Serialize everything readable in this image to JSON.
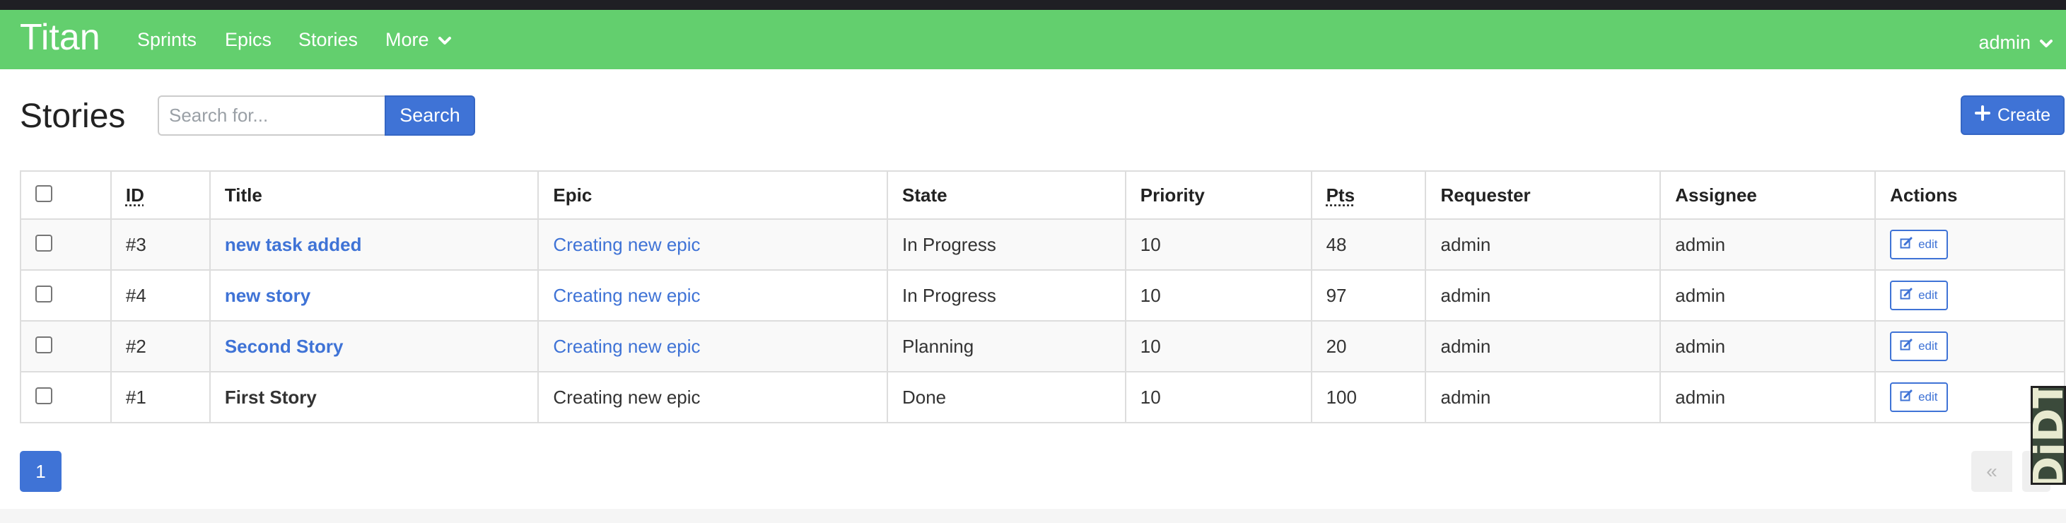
{
  "navbar": {
    "brand": "Titan",
    "items": [
      {
        "label": "Sprints"
      },
      {
        "label": "Epics"
      },
      {
        "label": "Stories"
      },
      {
        "label": "More"
      }
    ],
    "user": "admin"
  },
  "page": {
    "title": "Stories"
  },
  "search": {
    "placeholder": "Search for...",
    "button_label": "Search"
  },
  "create_button": {
    "label": "Create",
    "icon": "plus-icon"
  },
  "table": {
    "columns": [
      "ID",
      "Title",
      "Epic",
      "State",
      "Priority",
      "Pts",
      "Requester",
      "Assignee",
      "Actions"
    ],
    "rows": [
      {
        "id": "#3",
        "title": "new task added",
        "title_linked": true,
        "epic": "Creating new epic",
        "epic_linked": true,
        "state": "In Progress",
        "priority": "10",
        "pts": "48",
        "requester": "admin",
        "assignee": "admin",
        "action": "edit"
      },
      {
        "id": "#4",
        "title": "new story",
        "title_linked": true,
        "epic": "Creating new epic",
        "epic_linked": true,
        "state": "In Progress",
        "priority": "10",
        "pts": "97",
        "requester": "admin",
        "assignee": "admin",
        "action": "edit"
      },
      {
        "id": "#2",
        "title": "Second Story",
        "title_linked": true,
        "epic": "Creating new epic",
        "epic_linked": true,
        "state": "Planning",
        "priority": "10",
        "pts": "20",
        "requester": "admin",
        "assignee": "admin",
        "action": "edit"
      },
      {
        "id": "#1",
        "title": "First Story",
        "title_linked": false,
        "epic": "Creating new epic",
        "epic_linked": false,
        "state": "Done",
        "priority": "10",
        "pts": "100",
        "requester": "admin",
        "assignee": "admin",
        "action": "edit"
      }
    ]
  },
  "pagination": {
    "current": "1",
    "prev_symbol": "«"
  },
  "debug_toolbar": {
    "label": "DjDT"
  },
  "colors": {
    "navbar": "#63cf6e",
    "primary": "#3f73d6",
    "link": "#3f73d6"
  }
}
